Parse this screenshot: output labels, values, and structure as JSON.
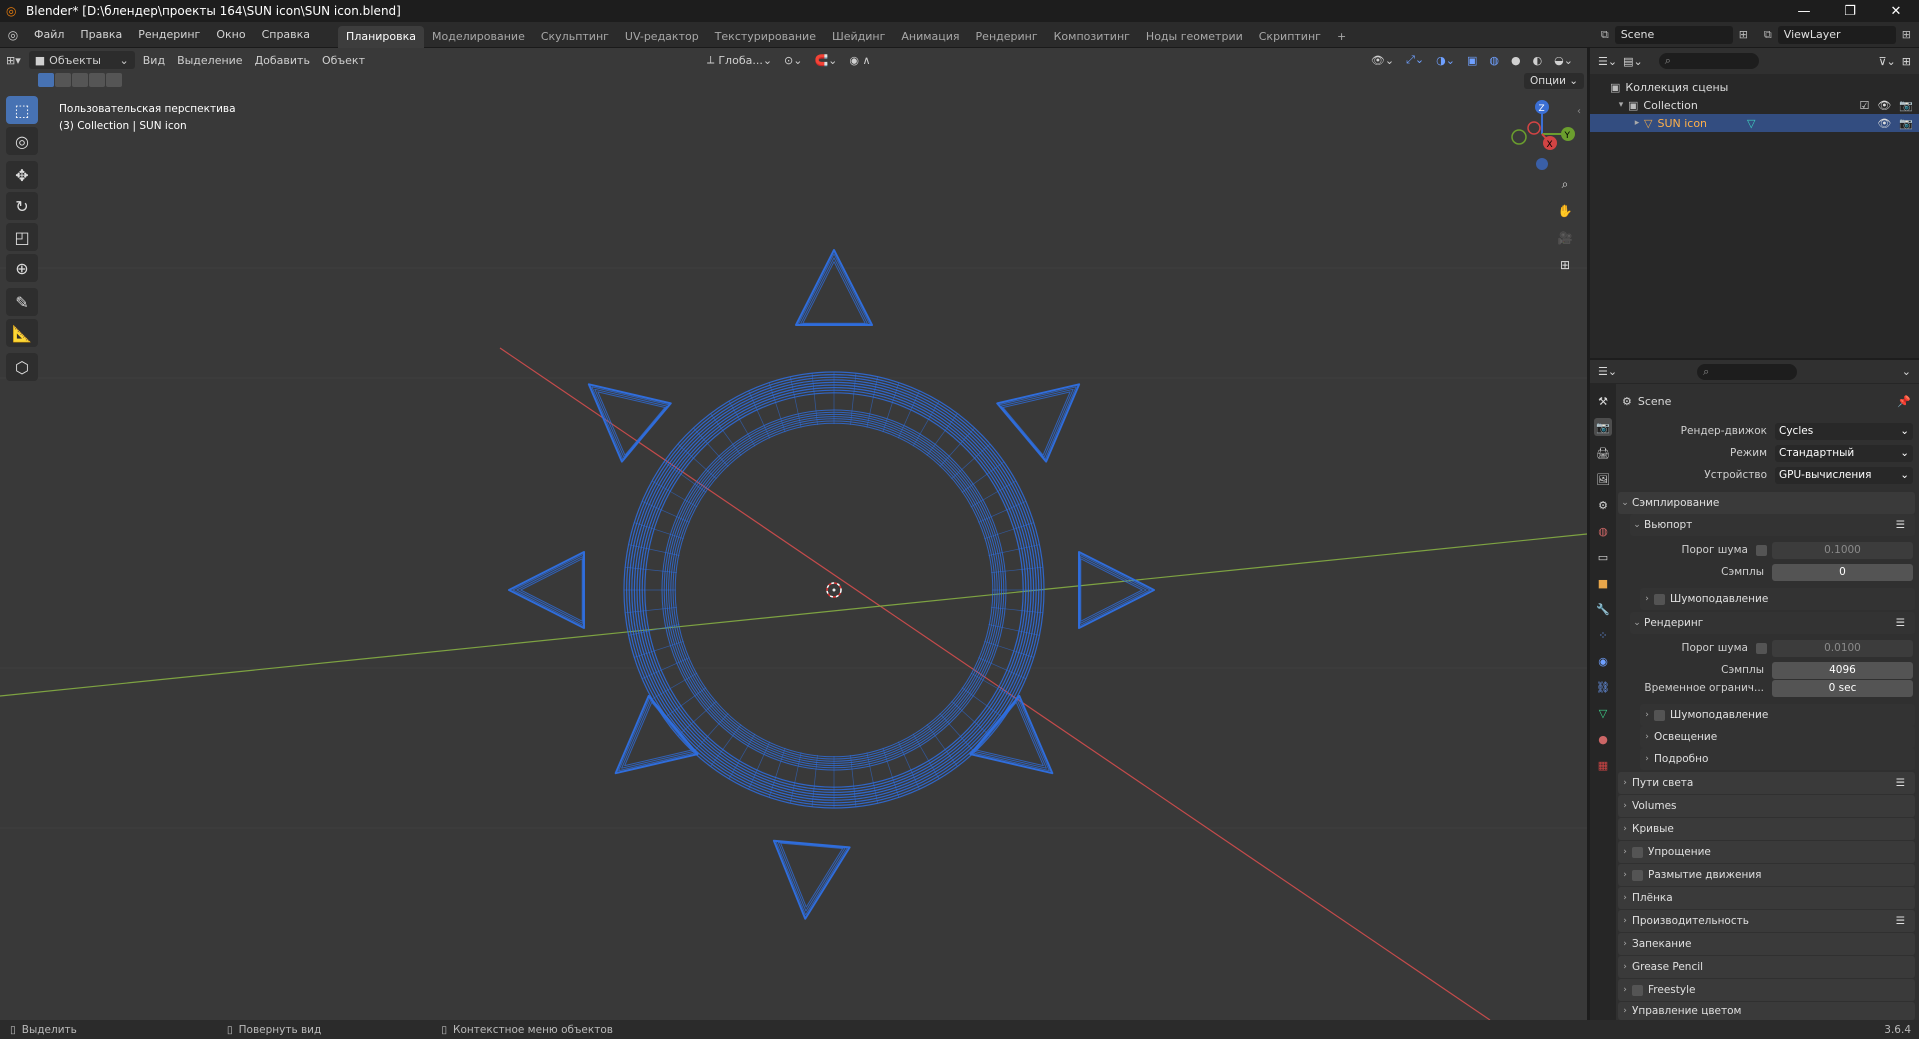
{
  "window": {
    "title": "Blender* [D:\\блендер\\проекты 164\\SUN icon\\SUN icon.blend]",
    "min": "—",
    "max": "❐",
    "close": "✕"
  },
  "menu": [
    "Файл",
    "Правка",
    "Рендеринг",
    "Окно",
    "Справка"
  ],
  "workspaces": {
    "tabs": [
      "Планировка",
      "Моделирование",
      "Скульптинг",
      "UV-редактор",
      "Текстурирование",
      "Шейдинг",
      "Анимация",
      "Рендеринг",
      "Композитинг",
      "Ноды геометрии",
      "Скриптинг"
    ],
    "active_index": 0,
    "add": "+"
  },
  "scene_selector": {
    "value": "Scene"
  },
  "viewlayer_selector": {
    "value": "ViewLayer"
  },
  "viewport_header": {
    "mode": "Объекты",
    "menus": [
      "Вид",
      "Выделение",
      "Добавить",
      "Объект"
    ],
    "orientation": "Глоба...",
    "options": "Опции"
  },
  "viewport": {
    "perspective": "Пользовательская перспектива",
    "collection_info": "(3) Collection | SUN icon",
    "wire_color": "#2f6fe0",
    "grid_x_color": "#c44b4b",
    "grid_y_color": "#7ea342"
  },
  "gizmo": {
    "x": "X",
    "y": "Y",
    "z": "Z"
  },
  "outliner": {
    "root": "Коллекция сцены",
    "collection": "Collection",
    "object": "SUN icon"
  },
  "properties": {
    "context": "Scene",
    "render_engine": {
      "label": "Рендер-движок",
      "value": "Cycles"
    },
    "mode": {
      "label": "Режим",
      "value": "Стандартный"
    },
    "device": {
      "label": "Устройство",
      "value": "GPU-вычисления"
    },
    "sampling": "Сэмплирование",
    "viewport_panel": "Вьюпорт",
    "vp_noise": {
      "label": "Порог шума",
      "value": "0.1000"
    },
    "vp_samples": {
      "label": "Сэмплы",
      "value": "0"
    },
    "vp_denoise": "Шумоподавление",
    "render_panel": "Рендеринг",
    "r_noise": {
      "label": "Порог шума",
      "value": "0.0100"
    },
    "r_samples": {
      "label": "Сэмплы",
      "value": "4096"
    },
    "r_time": {
      "label": "Временное огранич...",
      "value": "0 sec"
    },
    "r_denoise": "Шумоподавление",
    "lighting": "Освещение",
    "advanced": "Подробно",
    "panels": [
      "Пути света",
      "Volumes",
      "Кривые",
      "Упрощение",
      "Размытие движения",
      "Плёнка",
      "Производительность",
      "Запекание",
      "Grease Pencil",
      "Freestyle",
      "Управление цветом"
    ]
  },
  "statusbar": {
    "select": "Выделить",
    "rotate": "Повернуть вид",
    "context": "Контекстное меню объектов",
    "version": "3.6.4"
  }
}
